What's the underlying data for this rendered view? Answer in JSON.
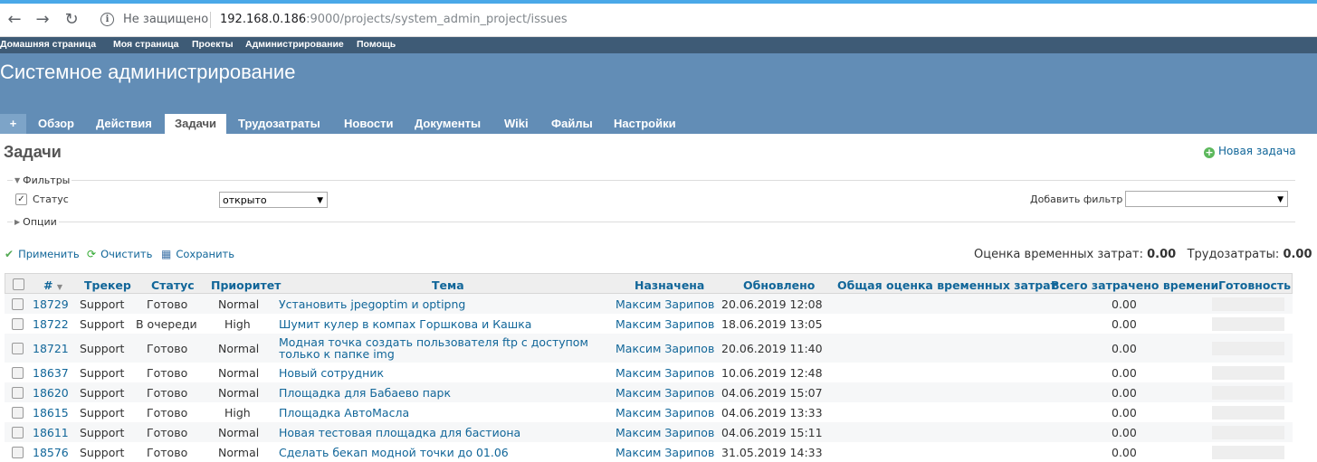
{
  "browser": {
    "insecure_label": "Не защищено",
    "url_host": "192.168.0.186",
    "url_rest": ":9000/projects/system_admin_project/issues"
  },
  "top_menu": [
    "Домашняя страница",
    "Моя страница",
    "Проекты",
    "Администрирование",
    "Помощь"
  ],
  "project_title": "Системное администрирование",
  "tabs": [
    {
      "label": "+"
    },
    {
      "label": "Обзор"
    },
    {
      "label": "Действия"
    },
    {
      "label": "Задачи"
    },
    {
      "label": "Трудозатраты"
    },
    {
      "label": "Новости"
    },
    {
      "label": "Документы"
    },
    {
      "label": "Wiki"
    },
    {
      "label": "Файлы"
    },
    {
      "label": "Настройки"
    }
  ],
  "active_tab": "Задачи",
  "page_title": "Задачи",
  "new_issue_label": "Новая задача",
  "filters": {
    "legend": "Фильтры",
    "status_label": "Статус",
    "status_value": "открыто",
    "add_filter_label": "Добавить фильтр",
    "add_filter_value": ""
  },
  "options_legend": "Опции",
  "actions": {
    "apply": "Применить",
    "clear": "Очистить",
    "save": "Сохранить"
  },
  "totals": {
    "estimated_label": "Оценка временных затрат:",
    "estimated_value": "0.00",
    "spent_label": "Трудозатраты:",
    "spent_value": "0.00"
  },
  "columns": [
    "#",
    "Трекер",
    "Статус",
    "Приоритет",
    "Тема",
    "Назначена",
    "Обновлено",
    "Общая оценка временных затрат",
    "Всего затрачено времени",
    "Готовность"
  ],
  "issues": [
    {
      "id": "18729",
      "tracker": "Support",
      "status": "Готово",
      "priority": "Normal",
      "subject": "Установить jpegoptim и optipng",
      "assignee": "Максим Зарипов",
      "updated": "20.06.2019 12:08",
      "total_estimated": "",
      "spent": "0.00",
      "done_ratio": 0
    },
    {
      "id": "18722",
      "tracker": "Support",
      "status": "В очереди",
      "priority": "High",
      "subject": "Шумит кулер в компах Горшкова и Кашка",
      "assignee": "Максим Зарипов",
      "updated": "18.06.2019 13:05",
      "total_estimated": "",
      "spent": "0.00",
      "done_ratio": 0
    },
    {
      "id": "18721",
      "tracker": "Support",
      "status": "Готово",
      "priority": "Normal",
      "subject": "Модная точка создать пользователя ftp с доступом только к папке img",
      "assignee": "Максим Зарипов",
      "updated": "20.06.2019 11:40",
      "total_estimated": "",
      "spent": "0.00",
      "done_ratio": 0
    },
    {
      "id": "18637",
      "tracker": "Support",
      "status": "Готово",
      "priority": "Normal",
      "subject": "Новый сотрудник",
      "assignee": "Максим Зарипов",
      "updated": "10.06.2019 12:48",
      "total_estimated": "",
      "spent": "0.00",
      "done_ratio": 0
    },
    {
      "id": "18620",
      "tracker": "Support",
      "status": "Готово",
      "priority": "Normal",
      "subject": "Площадка для Бабаево парк",
      "assignee": "Максим Зарипов",
      "updated": "04.06.2019 15:07",
      "total_estimated": "",
      "spent": "0.00",
      "done_ratio": 0
    },
    {
      "id": "18615",
      "tracker": "Support",
      "status": "Готово",
      "priority": "High",
      "subject": "Площадка АвтоМасла",
      "assignee": "Максим Зарипов",
      "updated": "04.06.2019 13:33",
      "total_estimated": "",
      "spent": "0.00",
      "done_ratio": 0
    },
    {
      "id": "18611",
      "tracker": "Support",
      "status": "Готово",
      "priority": "Normal",
      "subject": "Новая тестовая площадка для бастиона",
      "assignee": "Максим Зарипов",
      "updated": "04.06.2019 15:11",
      "total_estimated": "",
      "spent": "0.00",
      "done_ratio": 0
    },
    {
      "id": "18576",
      "tracker": "Support",
      "status": "Готово",
      "priority": "Normal",
      "subject": "Сделать бекап модной точки до 01.06",
      "assignee": "Максим Зарипов",
      "updated": "31.05.2019 14:33",
      "total_estimated": "",
      "spent": "0.00",
      "done_ratio": 0
    }
  ]
}
